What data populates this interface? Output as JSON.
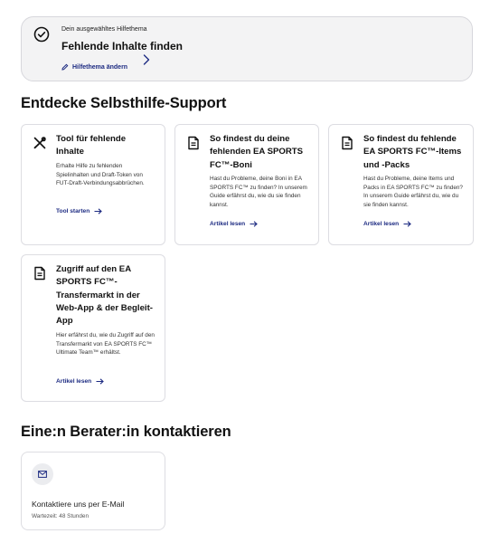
{
  "topic": {
    "small_label": "Dein ausgewähltes Hilfethema",
    "title": "Fehlende Inhalte finden",
    "change_link": "Hilfethema ändern"
  },
  "selfhelp": {
    "heading": "Entdecke Selbsthilfe-Support",
    "cards": [
      {
        "icon": "tools-icon",
        "title": "Tool für fehlende Inhalte",
        "description": "Erhalte Hilfe zu fehlenden Spielinhalten und Draft-Token von FUT-Draft-Verbindungsabbrüchen.",
        "cta": "Tool starten"
      },
      {
        "icon": "document-icon",
        "title": "So findest du deine fehlenden EA SPORTS FC™-Boni",
        "description": "Hast du Probleme, deine Boni in EA SPORTS FC™ zu finden? In unserem Guide erfährst du, wie du sie finden kannst.",
        "cta": "Artikel lesen"
      },
      {
        "icon": "document-icon",
        "title": "So findest du fehlende EA SPORTS FC™-Items und -Packs",
        "description": "Hast du Probleme, deine Items und Packs in EA SPORTS FC™ zu finden? In unserem Guide erfährst du, wie du sie finden kannst.",
        "cta": "Artikel lesen"
      },
      {
        "icon": "document-icon",
        "title": "Zugriff auf den EA SPORTS FC™-Transfermarkt in der Web-App & der Begleit-App",
        "description": "Hier erfährst du, wie du Zugriff auf den Transfermarkt von EA SPORTS FC™ Ultimate Team™ erhältst.",
        "cta": "Artikel lesen"
      }
    ]
  },
  "contact": {
    "heading": "Eine:n Berater:in kontaktieren",
    "email_label": "Kontaktiere uns per E-Mail",
    "wait_time": "Wartezeit: 48 Stunden"
  },
  "colors": {
    "link": "#1d2b82",
    "card_border": "#dddde2",
    "topic_bg": "#f3f3f4"
  }
}
